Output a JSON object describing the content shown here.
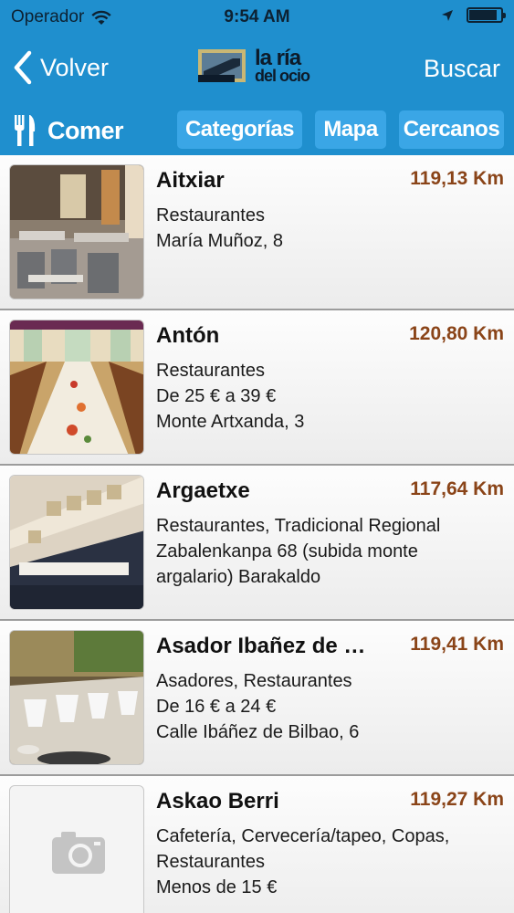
{
  "status_bar": {
    "carrier": "Operador",
    "time": "9:54 AM",
    "battery_level": 0.9
  },
  "nav": {
    "back_label": "Volver",
    "logo_line1": "la ría",
    "logo_line2": "del ocio",
    "search_label": "Buscar"
  },
  "section": {
    "title": "Comer",
    "tabs": [
      "Categorías",
      "Mapa",
      "Cercanos"
    ]
  },
  "items": [
    {
      "name": "Aitxiar",
      "distance": "119,13 Km",
      "lines": [
        "Restaurantes",
        "María Muñoz, 8"
      ],
      "photo": "restaurant-interior"
    },
    {
      "name": "Antón",
      "distance": "120,80 Km",
      "lines": [
        "Restaurantes",
        "De 25 € a 39 €",
        "Monte Artxanda, 3"
      ],
      "photo": "banquet-table"
    },
    {
      "name": "Argaetxe",
      "distance": "117,64 Km",
      "lines": [
        "Restaurantes, Tradicional Regional",
        "Zabalenkanpa 68 (subida monte",
        "argalario) Barakaldo"
      ],
      "photo": "dining-room"
    },
    {
      "name": "Asador Ibañez de …",
      "distance": "119,41 Km",
      "lines": [
        "Asadores, Restaurantes",
        "De 16 € a 24 €",
        "Calle Ibáñez de Bilbao, 6"
      ],
      "photo": "set-tables"
    },
    {
      "name": "Askao Berri",
      "distance": "119,27 Km",
      "lines": [
        "Cafetería, Cervecería/tapeo, Copas,",
        "Restaurantes",
        "Menos de 15 €"
      ],
      "photo": "camera-placeholder"
    }
  ],
  "colors": {
    "bar": "#1f8fce",
    "tab": "#3aa6e6",
    "distance": "#8a4418"
  }
}
